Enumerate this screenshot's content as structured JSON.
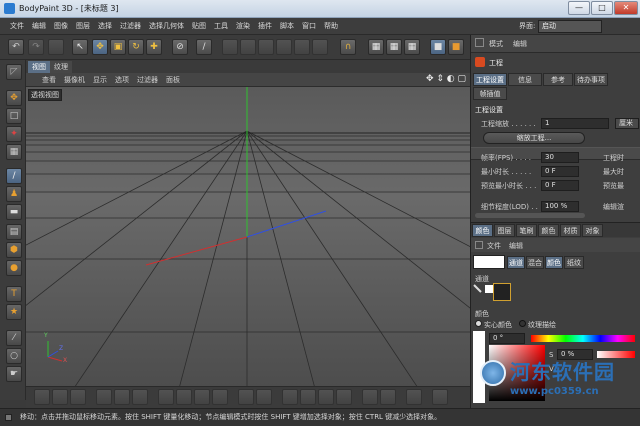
{
  "window": {
    "title": "BodyPaint 3D - [未标题 3]",
    "min_glyph": "—",
    "max_glyph": "□",
    "close_glyph": "✕"
  },
  "menu": [
    "文件",
    "编辑",
    "图像",
    "图层",
    "选择",
    "过滤器",
    "选择几何体",
    "贴图",
    "工具",
    "渲染",
    "插件",
    "脚本",
    "窗口",
    "帮助"
  ],
  "layout": {
    "label": "界面:",
    "value": "启动"
  },
  "viewport": {
    "tabs": [
      "视图",
      "纹理"
    ],
    "menu": [
      "查看",
      "摄像机",
      "显示",
      "选项",
      "过滤器",
      "面板"
    ],
    "label": "透视视图",
    "nav_icons": "✥ ⇕ ◐ ▢",
    "axis_x": "X",
    "axis_y": "Y",
    "axis_z": "Z"
  },
  "attr_panel": {
    "header_tabs": [
      "模式",
      "编辑"
    ],
    "object": "工程",
    "tabs": [
      "工程设置",
      "信息",
      "参考",
      "待办事项"
    ],
    "tab2": "帧插值",
    "section": "工程设置",
    "scale_label": "工程缩放 . . . . . .",
    "scale_value": "1",
    "scale_unit": "厘米",
    "scale_button": "缩放工程...",
    "rows": [
      {
        "label": "帧率(FPS) . . . .",
        "value": "30",
        "right": "工程时"
      },
      {
        "label": "最小时长 . . . . .",
        "value": "0 F",
        "right": "最大时"
      },
      {
        "label": "预览最小时长 . . .",
        "value": "0 F",
        "right": "预览最"
      },
      {
        "label": "细节程度(LOD) . .",
        "value": "100 %",
        "right": "编辑渲"
      }
    ]
  },
  "color_panel": {
    "tabs": [
      "颜色",
      "图层",
      "笔刷",
      "颜色",
      "材质",
      "对象"
    ],
    "menu": [
      "文件",
      "编辑"
    ],
    "mode_buttons": [
      "通道",
      "混合",
      "颜色",
      "纸纹"
    ],
    "channel_label": "通道",
    "color_label": "颜色",
    "radio1": "实心颜色",
    "radio2": "纹理描绘",
    "hue_value": "0 °",
    "s_label": "S",
    "s_value": "0 %",
    "v_label": "V"
  },
  "status": "移动：点击并拖动鼠标移动元素。按住 SHIFT 键量化移动；节点编辑模式时按住 SHIFT 键增加选择对象；按住 CTRL 键减少选择对象。",
  "watermark": {
    "brand": "河东软件园",
    "url": "www.pc0359.cn"
  },
  "colors": {
    "accent": "#5b6f86",
    "axis_x": "#d03030",
    "axis_y": "#30c030",
    "axis_z": "#3050e0"
  }
}
